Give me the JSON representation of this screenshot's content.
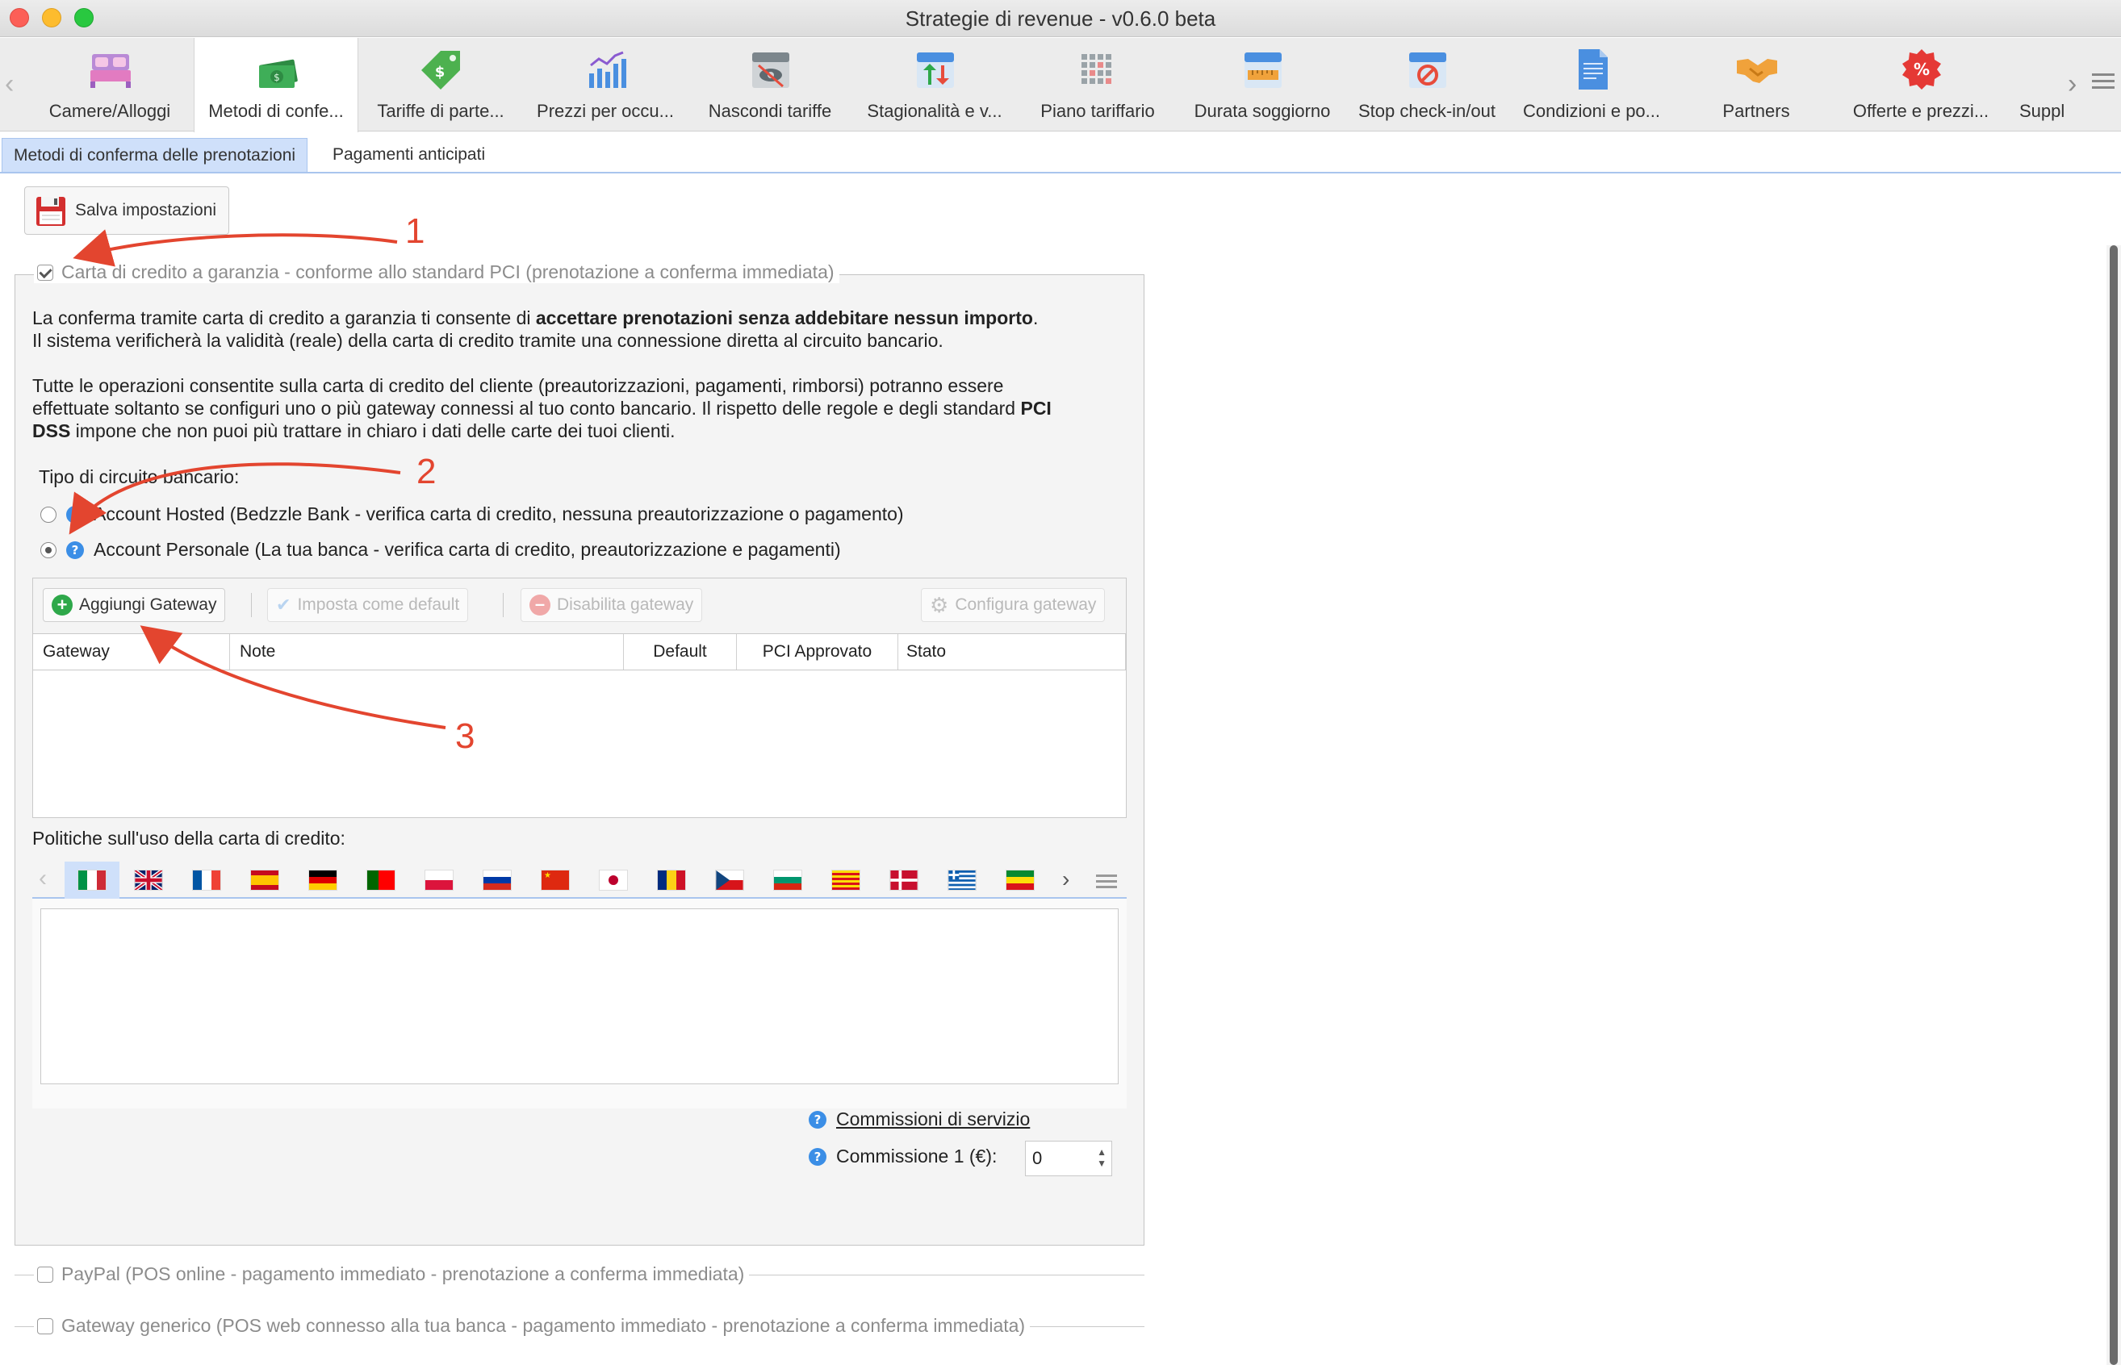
{
  "window": {
    "title": "Strategie di revenue - v0.6.0 beta"
  },
  "toolbar": {
    "items": [
      {
        "label": "Camere/Alloggi",
        "icon": "bed-icon"
      },
      {
        "label": "Metodi di confe...",
        "icon": "money-icon",
        "active": true
      },
      {
        "label": "Tariffe di parte...",
        "icon": "price-tag-icon"
      },
      {
        "label": "Prezzi per occu...",
        "icon": "bar-chart-icon"
      },
      {
        "label": "Nascondi tariffe",
        "icon": "hidden-calendar-icon"
      },
      {
        "label": "Stagionalità e v...",
        "icon": "up-down-calendar-icon"
      },
      {
        "label": "Piano tariffario",
        "icon": "grid-calendar-icon"
      },
      {
        "label": "Durata soggiorno",
        "icon": "ruler-calendar-icon"
      },
      {
        "label": "Stop check-in/out",
        "icon": "stop-calendar-icon"
      },
      {
        "label": "Condizioni e po...",
        "icon": "document-icon"
      },
      {
        "label": "Partners",
        "icon": "handshake-icon"
      },
      {
        "label": "Offerte e prezzi...",
        "icon": "percent-badge-icon"
      },
      {
        "label": "Suppl",
        "icon": "none"
      }
    ]
  },
  "subtabs": {
    "confirm_methods": "Metodi di conferma delle prenotazioni",
    "prepayments": "Pagamenti anticipati"
  },
  "save_button": {
    "label": "Salva impostazioni"
  },
  "credit_card_section": {
    "legend": "Carta di credito a garanzia - conforme allo standard PCI (prenotazione a conferma immediata)",
    "checked": true,
    "p1_a": "La conferma tramite carta di credito a garanzia ti consente di ",
    "p1_bold": "accettare prenotazioni senza addebitare nessun importo",
    "p1_b": ".",
    "p1_line2": "Il sistema verificherà la validità (reale) della carta di credito tramite una connessione diretta al circuito bancario.",
    "p2_line1": "Tutte le operazioni consentite sulla carta di credito del cliente (preautorizzazioni, pagamenti, rimborsi) potranno essere",
    "p2_line2_a": "effettuate soltanto se configuri uno o più gateway connessi al tuo conto bancario. Il rispetto delle regole e degli standard ",
    "p2_line2_bold": "PCI",
    "p2_line3_bold": "DSS",
    "p2_line3_b": " impone che non puoi più trattare in chiaro i dati delle carte dei tuoi clienti.",
    "circuit_title": "Tipo di circuito bancario:",
    "radio_hosted": "Account Hosted (Bedzzle Bank - verifica carta di credito, nessuna preautorizzazione o pagamento)",
    "radio_personal": "Account Personale (La tua banca - verifica carta di credito, preautorizzazione e pagamenti)",
    "selected_radio": "personal"
  },
  "gateway": {
    "add": "Aggiungi Gateway",
    "set_default": "Imposta come default",
    "disable": "Disabilita gateway",
    "configure": "Configura gateway",
    "columns": [
      "Gateway",
      "Note",
      "Default",
      "PCI Approvato",
      "Stato"
    ],
    "rows": []
  },
  "policies": {
    "label": "Politiche sull'uso della carta di credito:",
    "languages": [
      "it",
      "en",
      "fr",
      "es",
      "de",
      "pt",
      "pl",
      "ru",
      "zh",
      "ja",
      "ro",
      "cs",
      "bg",
      "ca",
      "da",
      "el",
      "et"
    ],
    "selected_language": "it",
    "text": ""
  },
  "fees": {
    "link": "Commissioni di servizio",
    "commission_label": "Commissione 1 (€):",
    "commission_value": "0"
  },
  "paypal_section": {
    "legend": "PayPal (POS online - pagamento immediato - prenotazione a conferma immediata)",
    "checked": false
  },
  "generic_gateway_section": {
    "legend": "Gateway generico (POS web connesso alla tua banca - pagamento immediato - prenotazione a conferma immediata)",
    "checked": false
  },
  "annotations": {
    "n1": "1",
    "n2": "2",
    "n3": "3",
    "color": "#e3452f"
  }
}
